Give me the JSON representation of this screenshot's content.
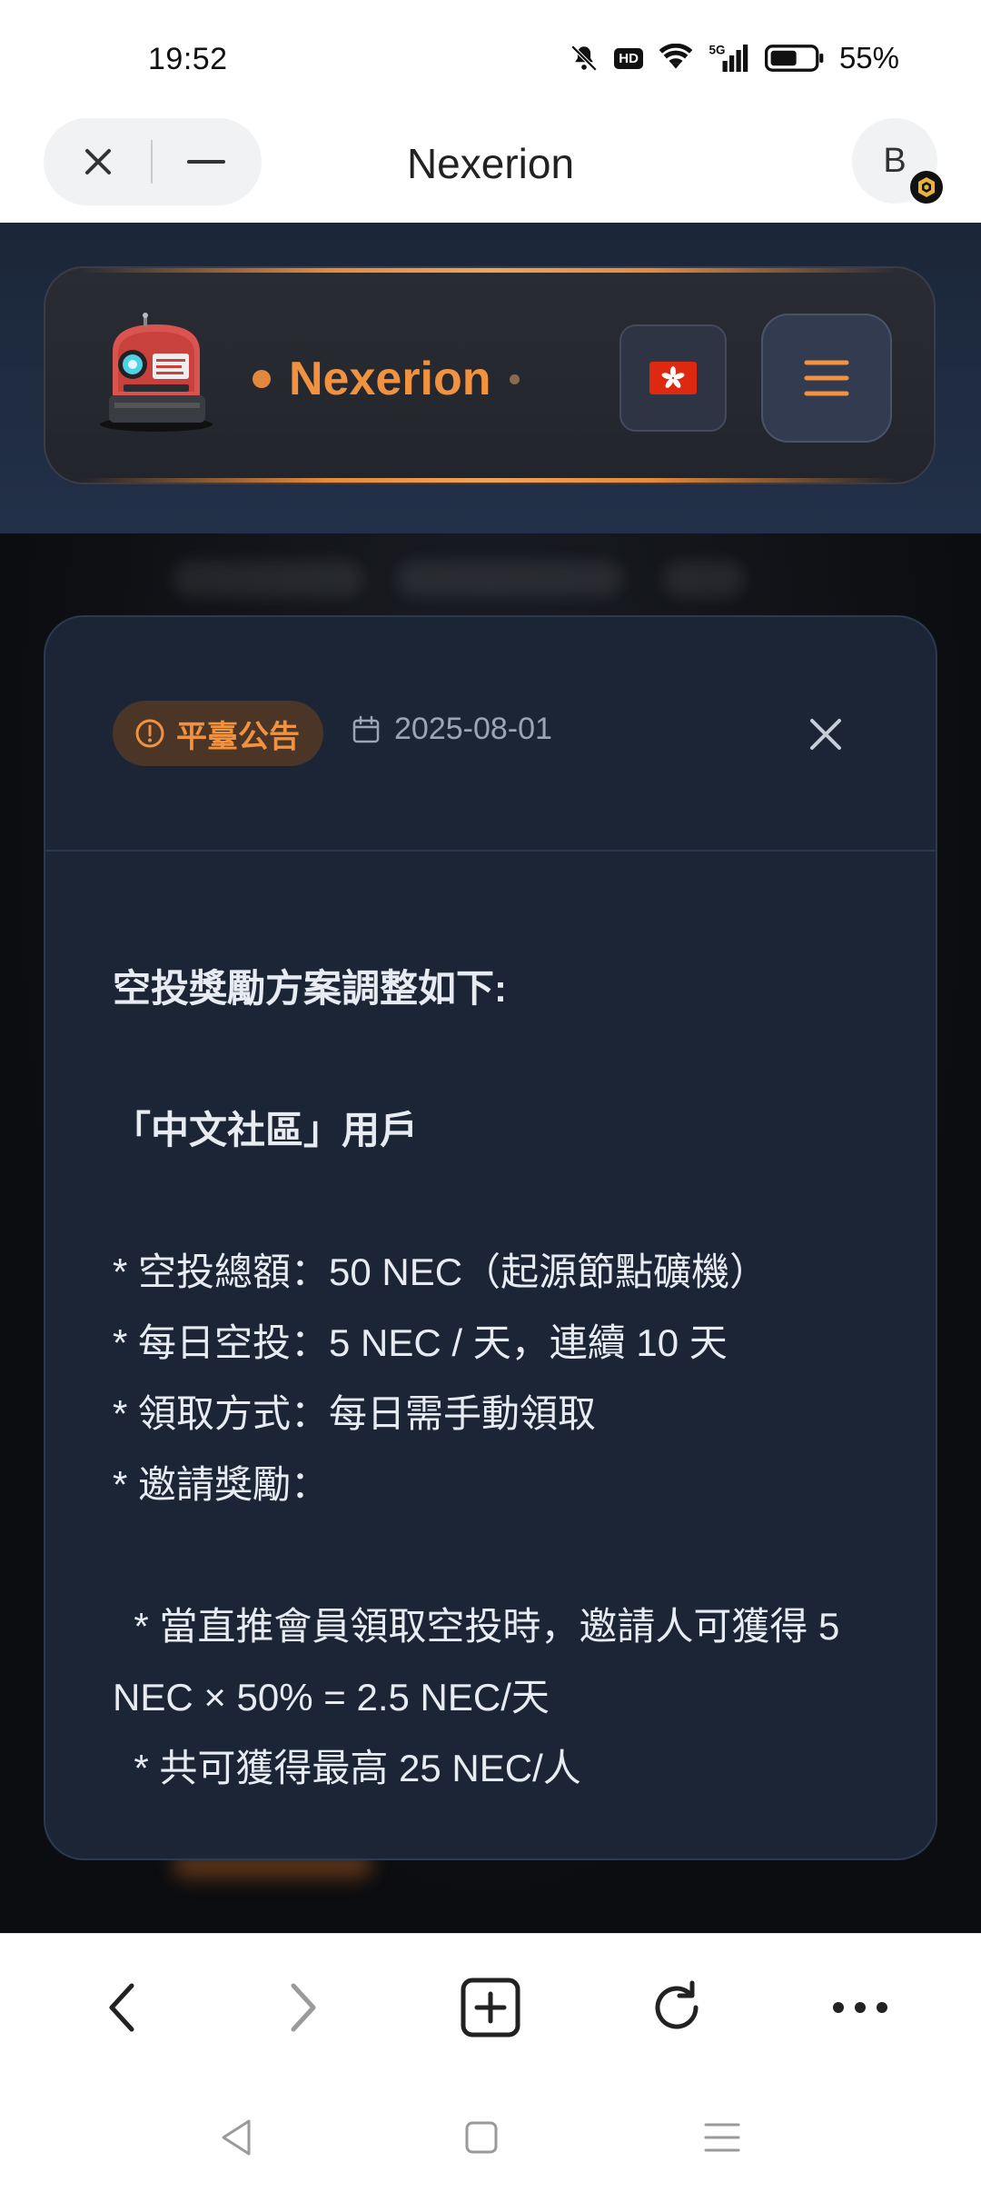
{
  "status_bar": {
    "time": "19:52",
    "hd_label": "HD",
    "network_label": "5G",
    "battery": "55%",
    "icons": [
      "mute-bell-icon",
      "hd-icon",
      "wifi-icon",
      "signal-5g-icon",
      "battery-icon"
    ]
  },
  "browser": {
    "title": "Nexerion",
    "profile_initial": "B",
    "controls": [
      "close-icon",
      "minimize-icon"
    ]
  },
  "site_header": {
    "brand": "Nexerion",
    "language_flag": "🇭🇰",
    "accent_color": "#f0923f"
  },
  "modal": {
    "tag_label": "平臺公告",
    "date": "2025-08-01",
    "lines": [
      "空投獎勵方案調整如下:",
      "",
      "「中文社區」用戶",
      "",
      "* 空投總額：50 NEC（起源節點礦機）",
      "* 每日空投：5 NEC / 天，連續 10 天",
      "* 領取方式：每日需手動領取",
      "* 邀請獎勵：",
      "",
      "  * 當直推會員領取空投時，邀請人可獲得 5 NEC × 50% = 2.5 NEC/天",
      "  * 共可獲得最高 25 NEC/人"
    ]
  },
  "bottom_bar": {
    "buttons": [
      "back-icon",
      "forward-icon",
      "new-tab-icon",
      "reload-icon",
      "more-icon"
    ]
  },
  "system_nav": {
    "buttons": [
      "nav-back-icon",
      "nav-home-icon",
      "nav-recents-icon"
    ]
  }
}
